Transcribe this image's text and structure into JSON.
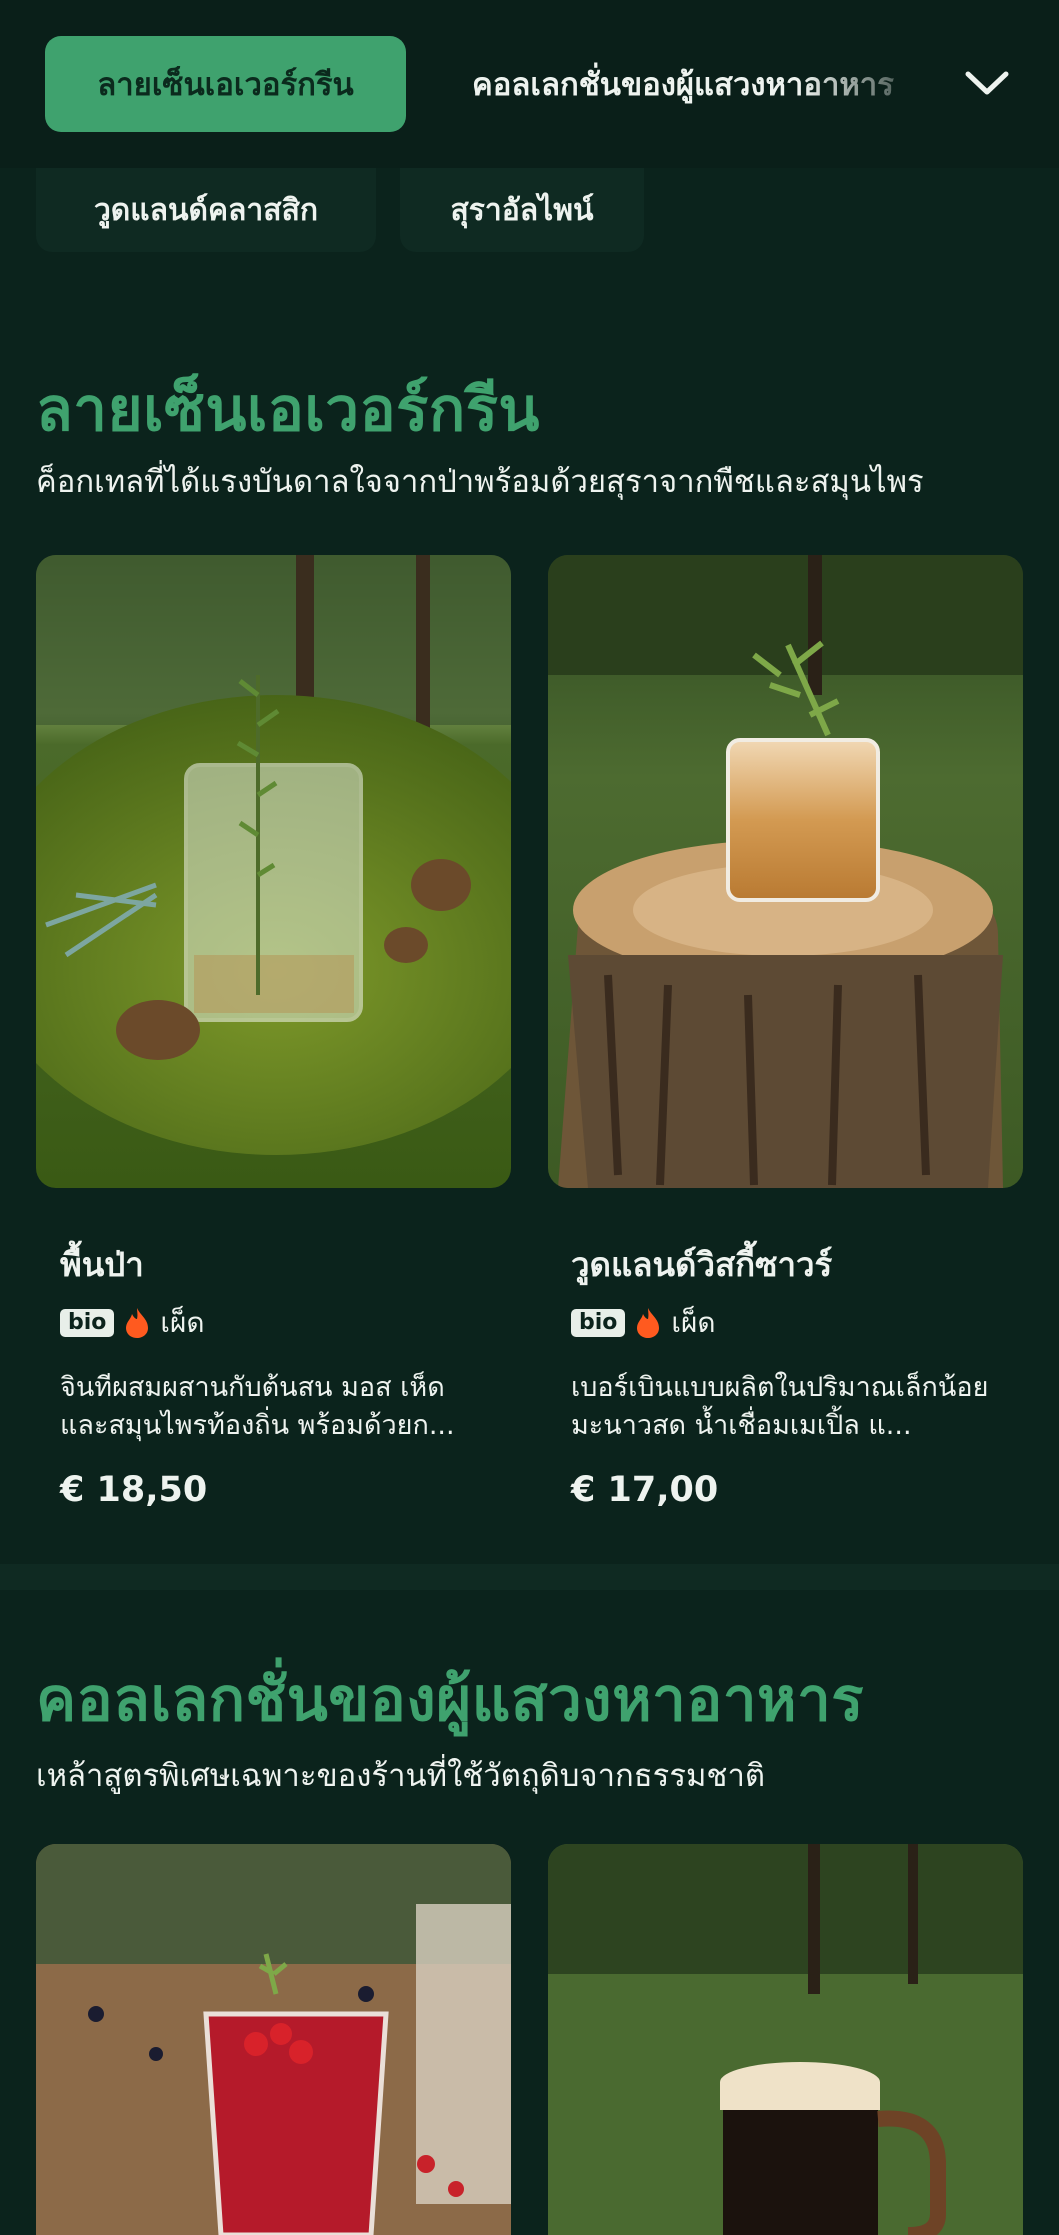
{
  "nav": {
    "active_category": "ลายเซ็นเอเวอร์กรีน",
    "next_category": "คอลเลกชั่นของผู้แสวงหาอาหาร",
    "row2": [
      "วูดแลนด์คลาสสิก",
      "สุราอัลไพน์"
    ],
    "expand_icon": "chevron-down-icon"
  },
  "sections": [
    {
      "title": "ลายเซ็นเอเวอร์กรีน",
      "subtitle": "ค็อกเทลที่ได้แรงบันดาลใจจากป่าพร้อมด้วยสุราจากพืชและสมุนไพร",
      "items": [
        {
          "name": "พื้นป่า",
          "badge": "bio",
          "tag": "เผ็ด",
          "description": "จินทีผสมผสานกับต้นสน มอส เห็ด และสมุนไพรท้องถิ่น พร้อมด้วยก...",
          "price": "€ 18,50"
        },
        {
          "name": "วูดแลนด์วิสกี้ซาวร์",
          "badge": "bio",
          "tag": "เผ็ด",
          "description": "เบอร์เบินแบบผลิตในปริมาณเล็กน้อย มะนาวสด น้ำเชื่อมเมเปิ้ล แ...",
          "price": "€ 17,00"
        }
      ]
    },
    {
      "title": "คอลเลกชั่นของผู้แสวงหาอาหาร",
      "subtitle": "เหล้าสูตรพิเศษเฉพาะของร้านที่ใช้วัตถุดิบจากธรรมชาติ"
    }
  ],
  "colors": {
    "background": "#0b231c",
    "accent": "#3fa26e",
    "flame": "#ff5a1f"
  }
}
